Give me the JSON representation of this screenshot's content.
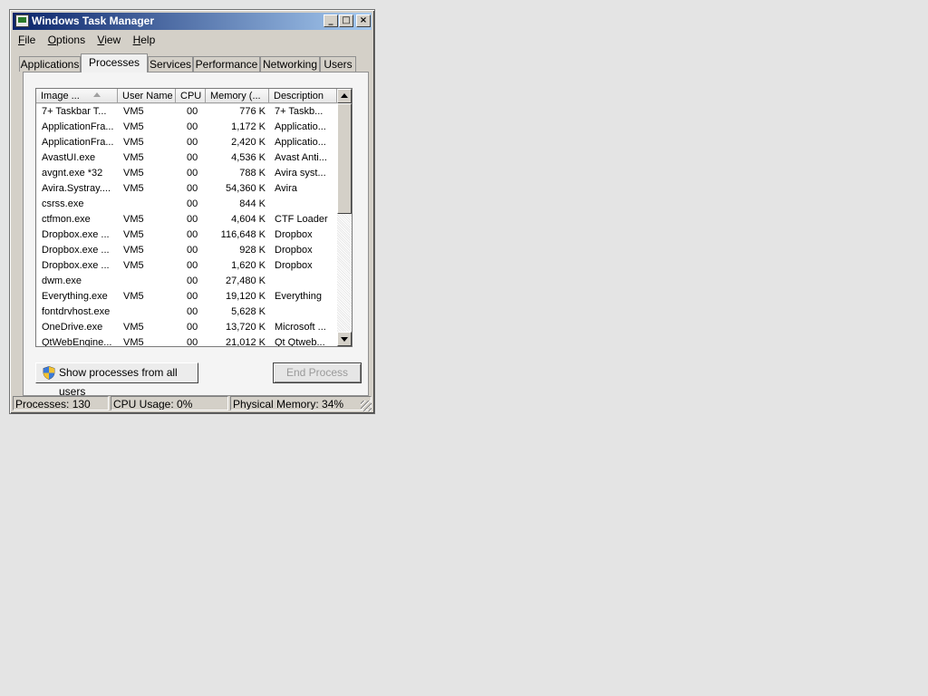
{
  "window": {
    "title": "Windows Task Manager",
    "controls": {
      "minimize": "_",
      "maximize": "□",
      "close": "×"
    }
  },
  "menu": [
    {
      "mnemonic": "F",
      "rest": "ile"
    },
    {
      "mnemonic": "O",
      "rest": "ptions"
    },
    {
      "mnemonic": "V",
      "rest": "iew"
    },
    {
      "mnemonic": "H",
      "rest": "elp"
    }
  ],
  "tabs": [
    {
      "label": "Applications",
      "active": false
    },
    {
      "label": "Processes",
      "active": true
    },
    {
      "label": "Services",
      "active": false
    },
    {
      "label": "Performance",
      "active": false
    },
    {
      "label": "Networking",
      "active": false
    },
    {
      "label": "Users",
      "active": false
    }
  ],
  "table": {
    "columns": [
      "Image ...",
      "User Name",
      "CPU",
      "Memory (...",
      "Description"
    ],
    "rows": [
      [
        "7+ Taskbar T...",
        "VM5",
        "00",
        "776 K",
        "7+ Taskb..."
      ],
      [
        "ApplicationFra...",
        "VM5",
        "00",
        "1,172 K",
        "Applicatio..."
      ],
      [
        "ApplicationFra...",
        "VM5",
        "00",
        "2,420 K",
        "Applicatio..."
      ],
      [
        "AvastUI.exe",
        "VM5",
        "00",
        "4,536 K",
        "Avast Anti..."
      ],
      [
        "avgnt.exe *32",
        "VM5",
        "00",
        "788 K",
        "Avira syst..."
      ],
      [
        "Avira.Systray....",
        "VM5",
        "00",
        "54,360 K",
        "Avira"
      ],
      [
        "csrss.exe",
        "",
        "00",
        "844 K",
        ""
      ],
      [
        "ctfmon.exe",
        "VM5",
        "00",
        "4,604 K",
        "CTF Loader"
      ],
      [
        "Dropbox.exe ...",
        "VM5",
        "00",
        "116,648 K",
        "Dropbox"
      ],
      [
        "Dropbox.exe ...",
        "VM5",
        "00",
        "928 K",
        "Dropbox"
      ],
      [
        "Dropbox.exe ...",
        "VM5",
        "00",
        "1,620 K",
        "Dropbox"
      ],
      [
        "dwm.exe",
        "",
        "00",
        "27,480 K",
        ""
      ],
      [
        "Everything.exe",
        "VM5",
        "00",
        "19,120 K",
        "Everything"
      ],
      [
        "fontdrvhost.exe",
        "",
        "00",
        "5,628 K",
        ""
      ],
      [
        "OneDrive.exe",
        "VM5",
        "00",
        "13,720 K",
        "Microsoft ..."
      ],
      [
        "QtWebEngine...",
        "VM5",
        "00",
        "21,012 K",
        "Qt Qtweb..."
      ]
    ]
  },
  "buttons": {
    "show_all": "Show processes from all users",
    "end_process": "End Process"
  },
  "status": {
    "processes": "Processes: 130",
    "cpu": "CPU Usage: 0%",
    "memory": "Physical Memory: 34%"
  },
  "icons": {
    "app": "task-manager-icon",
    "shield": "uac-shield-icon"
  }
}
